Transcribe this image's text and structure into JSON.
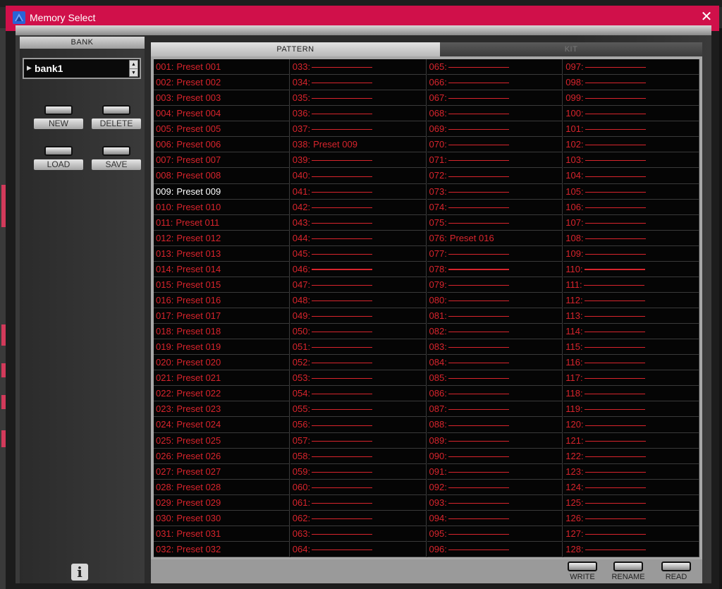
{
  "window": {
    "title": "Memory Select"
  },
  "bank": {
    "header": "BANK",
    "selected": "bank1",
    "buttons": {
      "new": "NEW",
      "delete": "DELETE",
      "load": "LOAD",
      "save": "SAVE"
    }
  },
  "tabs": {
    "pattern": "PATTERN",
    "kit": "KIT"
  },
  "grid": {
    "selected": 9,
    "cells": [
      {
        "num": "001:",
        "name": "Preset 001"
      },
      {
        "num": "002:",
        "name": "Preset 002"
      },
      {
        "num": "003:",
        "name": "Preset 003"
      },
      {
        "num": "004:",
        "name": "Preset 004"
      },
      {
        "num": "005:",
        "name": "Preset 005"
      },
      {
        "num": "006:",
        "name": "Preset 006"
      },
      {
        "num": "007:",
        "name": "Preset 007"
      },
      {
        "num": "008:",
        "name": "Preset 008"
      },
      {
        "num": "009:",
        "name": "Preset 009"
      },
      {
        "num": "010:",
        "name": "Preset 010"
      },
      {
        "num": "011:",
        "name": "Preset 011"
      },
      {
        "num": "012:",
        "name": "Preset 012"
      },
      {
        "num": "013:",
        "name": "Preset 013"
      },
      {
        "num": "014:",
        "name": "Preset 014"
      },
      {
        "num": "015:",
        "name": "Preset 015"
      },
      {
        "num": "016:",
        "name": "Preset 016"
      },
      {
        "num": "017:",
        "name": "Preset 017"
      },
      {
        "num": "018:",
        "name": "Preset 018"
      },
      {
        "num": "019:",
        "name": "Preset 019"
      },
      {
        "num": "020:",
        "name": "Preset 020"
      },
      {
        "num": "021:",
        "name": "Preset 021"
      },
      {
        "num": "022:",
        "name": "Preset 022"
      },
      {
        "num": "023:",
        "name": "Preset 023"
      },
      {
        "num": "024:",
        "name": "Preset 024"
      },
      {
        "num": "025:",
        "name": "Preset 025"
      },
      {
        "num": "026:",
        "name": "Preset 026"
      },
      {
        "num": "027:",
        "name": "Preset 027"
      },
      {
        "num": "028:",
        "name": "Preset 028"
      },
      {
        "num": "029:",
        "name": "Preset 029"
      },
      {
        "num": "030:",
        "name": "Preset 030"
      },
      {
        "num": "031:",
        "name": "Preset 031"
      },
      {
        "num": "032:",
        "name": "Preset 032"
      },
      {
        "num": "033:",
        "name": ""
      },
      {
        "num": "034:",
        "name": ""
      },
      {
        "num": "035:",
        "name": ""
      },
      {
        "num": "036:",
        "name": ""
      },
      {
        "num": "037:",
        "name": ""
      },
      {
        "num": "038:",
        "name": "Preset 009"
      },
      {
        "num": "039:",
        "name": ""
      },
      {
        "num": "040:",
        "name": ""
      },
      {
        "num": "041:",
        "name": ""
      },
      {
        "num": "042:",
        "name": ""
      },
      {
        "num": "043:",
        "name": ""
      },
      {
        "num": "044:",
        "name": ""
      },
      {
        "num": "045:",
        "name": ""
      },
      {
        "num": "046:",
        "name": "",
        "bold": true
      },
      {
        "num": "047:",
        "name": ""
      },
      {
        "num": "048:",
        "name": ""
      },
      {
        "num": "049:",
        "name": ""
      },
      {
        "num": "050:",
        "name": ""
      },
      {
        "num": "051:",
        "name": ""
      },
      {
        "num": "052:",
        "name": ""
      },
      {
        "num": "053:",
        "name": ""
      },
      {
        "num": "054:",
        "name": ""
      },
      {
        "num": "055:",
        "name": ""
      },
      {
        "num": "056:",
        "name": ""
      },
      {
        "num": "057:",
        "name": ""
      },
      {
        "num": "058:",
        "name": ""
      },
      {
        "num": "059:",
        "name": ""
      },
      {
        "num": "060:",
        "name": ""
      },
      {
        "num": "061:",
        "name": ""
      },
      {
        "num": "062:",
        "name": ""
      },
      {
        "num": "063:",
        "name": ""
      },
      {
        "num": "064:",
        "name": ""
      },
      {
        "num": "065:",
        "name": ""
      },
      {
        "num": "066:",
        "name": ""
      },
      {
        "num": "067:",
        "name": ""
      },
      {
        "num": "068:",
        "name": ""
      },
      {
        "num": "069:",
        "name": ""
      },
      {
        "num": "070:",
        "name": ""
      },
      {
        "num": "071:",
        "name": ""
      },
      {
        "num": "072:",
        "name": ""
      },
      {
        "num": "073:",
        "name": ""
      },
      {
        "num": "074:",
        "name": ""
      },
      {
        "num": "075:",
        "name": ""
      },
      {
        "num": "076:",
        "name": "Preset 016"
      },
      {
        "num": "077:",
        "name": ""
      },
      {
        "num": "078:",
        "name": "",
        "bold": true
      },
      {
        "num": "079:",
        "name": ""
      },
      {
        "num": "080:",
        "name": ""
      },
      {
        "num": "081:",
        "name": ""
      },
      {
        "num": "082:",
        "name": ""
      },
      {
        "num": "083:",
        "name": ""
      },
      {
        "num": "084:",
        "name": ""
      },
      {
        "num": "085:",
        "name": ""
      },
      {
        "num": "086:",
        "name": ""
      },
      {
        "num": "087:",
        "name": ""
      },
      {
        "num": "088:",
        "name": ""
      },
      {
        "num": "089:",
        "name": ""
      },
      {
        "num": "090:",
        "name": ""
      },
      {
        "num": "091:",
        "name": ""
      },
      {
        "num": "092:",
        "name": ""
      },
      {
        "num": "093:",
        "name": ""
      },
      {
        "num": "094:",
        "name": ""
      },
      {
        "num": "095:",
        "name": ""
      },
      {
        "num": "096:",
        "name": ""
      },
      {
        "num": "097:",
        "name": ""
      },
      {
        "num": "098:",
        "name": ""
      },
      {
        "num": "099:",
        "name": ""
      },
      {
        "num": "100:",
        "name": ""
      },
      {
        "num": "101:",
        "name": ""
      },
      {
        "num": "102:",
        "name": ""
      },
      {
        "num": "103:",
        "name": ""
      },
      {
        "num": "104:",
        "name": ""
      },
      {
        "num": "105:",
        "name": ""
      },
      {
        "num": "106:",
        "name": ""
      },
      {
        "num": "107:",
        "name": ""
      },
      {
        "num": "108:",
        "name": ""
      },
      {
        "num": "109:",
        "name": ""
      },
      {
        "num": "110:",
        "name": "",
        "bold": true
      },
      {
        "num": "111:",
        "name": ""
      },
      {
        "num": "112:",
        "name": ""
      },
      {
        "num": "113:",
        "name": ""
      },
      {
        "num": "114:",
        "name": ""
      },
      {
        "num": "115:",
        "name": ""
      },
      {
        "num": "116:",
        "name": ""
      },
      {
        "num": "117:",
        "name": ""
      },
      {
        "num": "118:",
        "name": ""
      },
      {
        "num": "119:",
        "name": ""
      },
      {
        "num": "120:",
        "name": ""
      },
      {
        "num": "121:",
        "name": ""
      },
      {
        "num": "122:",
        "name": ""
      },
      {
        "num": "123:",
        "name": ""
      },
      {
        "num": "124:",
        "name": ""
      },
      {
        "num": "125:",
        "name": ""
      },
      {
        "num": "126:",
        "name": ""
      },
      {
        "num": "127:",
        "name": ""
      },
      {
        "num": "128:",
        "name": ""
      }
    ]
  },
  "footer": {
    "write": "WRITE",
    "rename": "RENAME",
    "read": "READ"
  },
  "colors": {
    "titlebar": "#d0104a",
    "preset_text": "#d8242c",
    "selected_text": "#ffffff"
  },
  "icons": {
    "app": "app-logo-icon",
    "close": "close-icon",
    "info": "info-icon"
  }
}
